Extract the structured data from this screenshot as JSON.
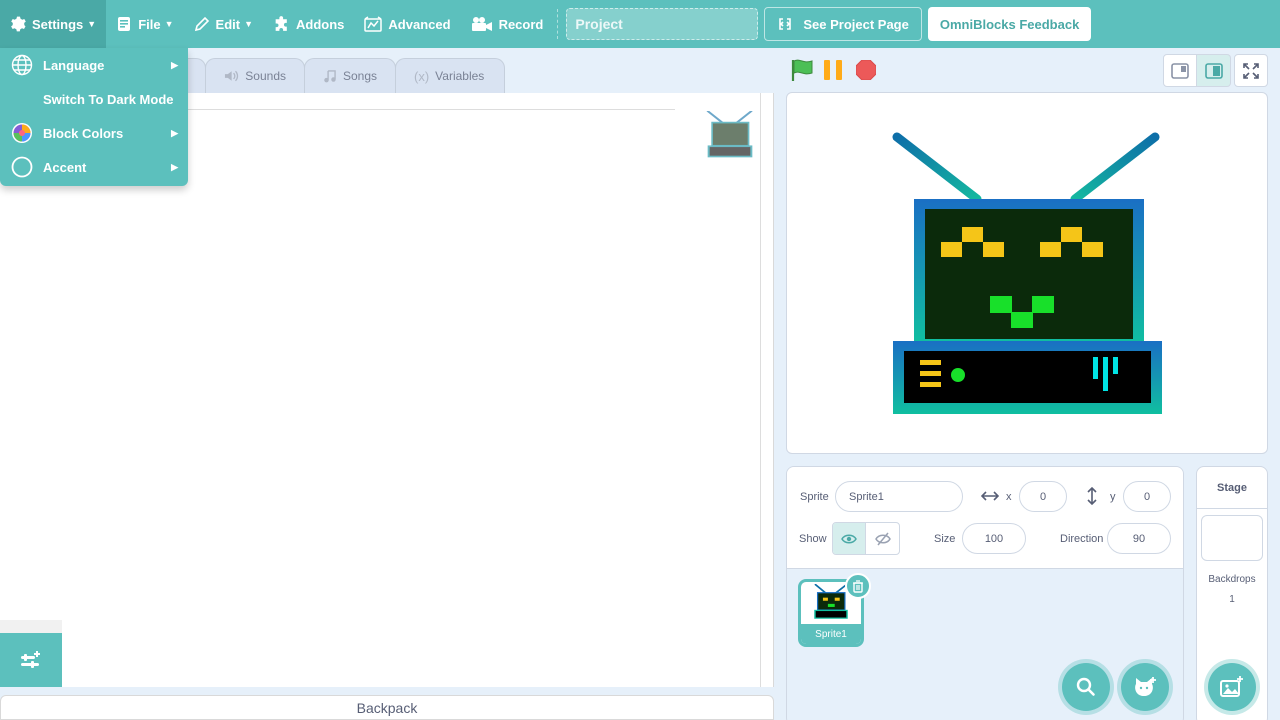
{
  "menubar": {
    "settings": "Settings",
    "file": "File",
    "edit": "Edit",
    "addons": "Addons",
    "advanced": "Advanced",
    "record": "Record",
    "project_placeholder": "Project",
    "see_project": "See Project Page",
    "feedback": "OmniBlocks Feedback"
  },
  "settings_menu": {
    "items": [
      {
        "label": "Language",
        "icon": "globe-icon",
        "has_submenu": true
      },
      {
        "label": "Switch To Dark Mode",
        "icon": "moon-icon",
        "has_submenu": false
      },
      {
        "label": "Block Colors",
        "icon": "palette-icon",
        "has_submenu": true
      },
      {
        "label": "Accent",
        "icon": "circle-icon",
        "has_submenu": true
      }
    ]
  },
  "tabs": {
    "sounds": "Sounds",
    "songs": "Songs",
    "variables": "Variables"
  },
  "backpack": "Backpack",
  "sprite_info": {
    "sprite_label": "Sprite",
    "sprite_name": "Sprite1",
    "x_label": "x",
    "x_value": "0",
    "y_label": "y",
    "y_value": "0",
    "show_label": "Show",
    "size_label": "Size",
    "size_value": "100",
    "direction_label": "Direction",
    "direction_value": "90"
  },
  "sprites": [
    {
      "name": "Sprite1"
    }
  ],
  "stage_pane": {
    "title": "Stage",
    "backdrops_label": "Backdrops",
    "backdrops_count": "1"
  },
  "colors": {
    "accent": "#5cc0bd",
    "accent_dark": "#4aa9a6",
    "background": "#e6f0fa"
  }
}
